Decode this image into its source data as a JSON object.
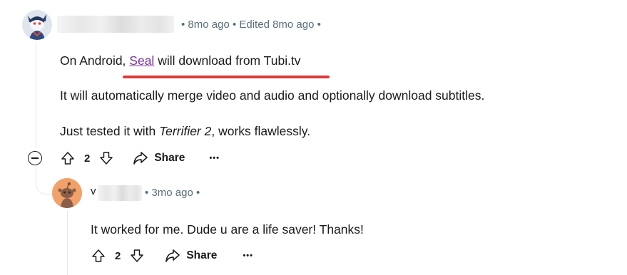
{
  "comment": {
    "meta": "• 8mo ago • Edited 8mo ago •",
    "body": {
      "line1_prefix": "On Android, ",
      "line1_link": "Seal",
      "line1_suffix": " will download from Tubi.tv",
      "line2": "It will automatically merge video and audio and optionally download subtitles.",
      "line3_prefix": "Just tested it with ",
      "line3_italic": "Terrifier 2",
      "line3_suffix": ", works flawlessly."
    },
    "votes": "2",
    "share_label": "Share",
    "more_label": "•••"
  },
  "reply": {
    "name_initial": "v",
    "meta": "• 3mo ago •",
    "body": "It worked for me. Dude u are a life saver! Thanks!",
    "votes": "2",
    "share_label": "Share",
    "more_label": "•••"
  },
  "colors": {
    "link": "#7a2fa2",
    "highlight_underline": "#e03a3a",
    "meta_text": "#576f76"
  },
  "icons": [
    "upvote-icon",
    "downvote-icon",
    "share-icon",
    "more-icon",
    "collapse-icon"
  ]
}
